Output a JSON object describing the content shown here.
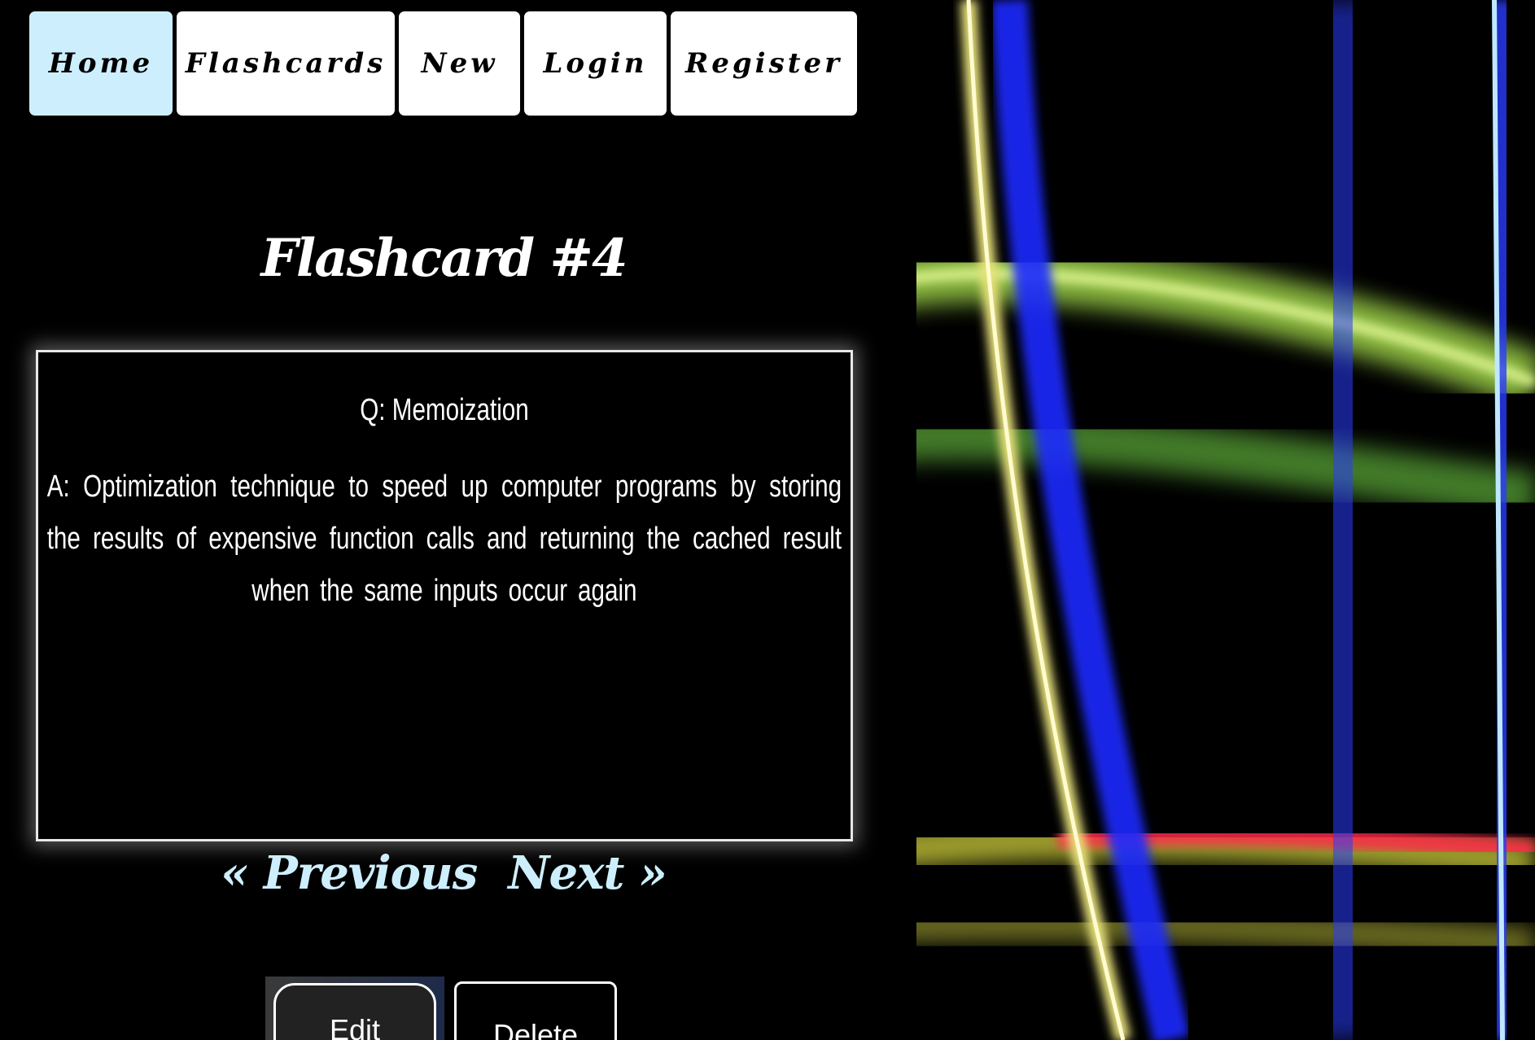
{
  "nav": {
    "items": [
      {
        "label": "Home",
        "active": true
      },
      {
        "label": "Flashcards",
        "active": false
      },
      {
        "label": "New",
        "active": false
      },
      {
        "label": "Login",
        "active": false
      },
      {
        "label": "Register",
        "active": false
      }
    ]
  },
  "flashcard": {
    "title": "Flashcard #4",
    "question": "Q: Memoization",
    "answer": "A: Optimization technique to speed up computer programs by storing the results of expensive function calls and returning the cached result when the same inputs occur again"
  },
  "pager": {
    "previous_label": "« Previous",
    "next_label": "Next »"
  },
  "actions": {
    "edit_label": "Edit",
    "delete_label": "Delete"
  },
  "colors": {
    "active_nav": "#cdeffd",
    "pager_text": "#cdeffd",
    "background": "#000000"
  }
}
